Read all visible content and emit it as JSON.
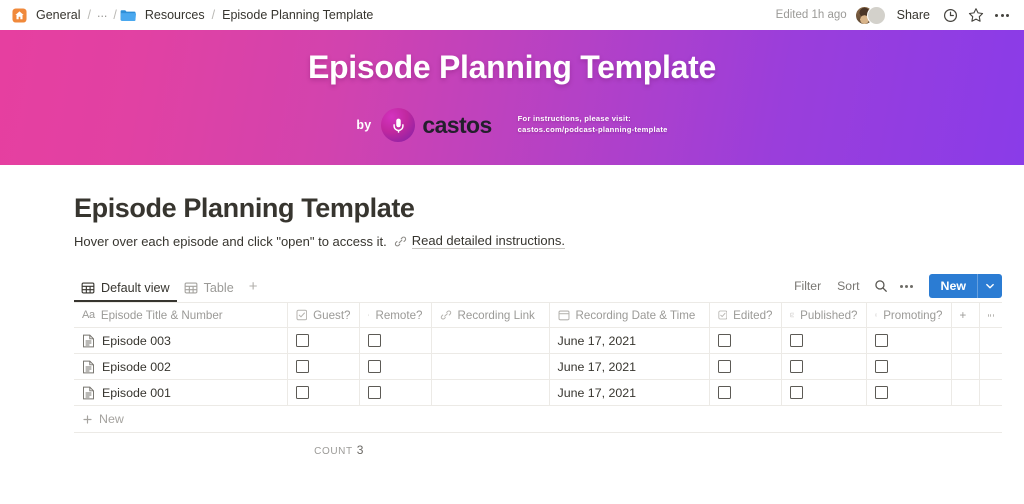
{
  "topbar": {
    "breadcrumb": {
      "home_icon": "home-icon",
      "home_label": "General",
      "sep": "/",
      "ellipsis": "...",
      "folder_icon": "folder-icon",
      "folder_label": "Resources",
      "page_label": "Episode Planning Template"
    },
    "edited_text": "Edited 1h ago",
    "share_label": "Share",
    "icons": [
      "clock-icon",
      "star-icon",
      "more-options-icon"
    ]
  },
  "banner": {
    "title": "Episode Planning Template",
    "by_word": "by",
    "brand": "castos",
    "mic_icon": "microphone-icon",
    "note_line1": "For instructions, please visit:",
    "note_line2": "castos.com/podcast-planning-template",
    "gradient_start": "#e63fa0",
    "gradient_end": "#8a3ce8"
  },
  "page": {
    "title": "Episode Planning Template",
    "subtitle": "Hover over each episode and click \"open\" to access it.",
    "link_icon": "link-icon",
    "link_label": "Read detailed instructions."
  },
  "view": {
    "tabs": [
      {
        "label": "Default view",
        "icon": "table-grid-icon",
        "active": true
      },
      {
        "label": "Table",
        "icon": "table-grid-icon",
        "active": false
      }
    ],
    "add_view_label": "+",
    "tools": {
      "filter_label": "Filter",
      "sort_label": "Sort",
      "search_icon": "search-icon",
      "more_icon": "more-options-icon",
      "new_label": "New",
      "new_chevron_icon": "chevron-down-icon",
      "new_color": "#2b7cd3"
    }
  },
  "table": {
    "columns": [
      {
        "label": "Episode Title & Number",
        "icon": "text-type-icon"
      },
      {
        "label": "Guest?",
        "icon": "checkbox-type-icon"
      },
      {
        "label": "Remote?",
        "icon": "checkbox-type-icon"
      },
      {
        "label": "Recording Link",
        "icon": "link-type-icon"
      },
      {
        "label": "Recording Date & Time",
        "icon": "calendar-type-icon"
      },
      {
        "label": "Edited?",
        "icon": "checkbox-type-icon"
      },
      {
        "label": "Published?",
        "icon": "checkbox-type-icon"
      },
      {
        "label": "Promoting?",
        "icon": "checkbox-type-icon"
      }
    ],
    "add_column_label": "+",
    "column_options_icon": "more-options-icon",
    "rows": [
      {
        "icon": "page-doc-icon",
        "title": "Episode 003",
        "guest": false,
        "remote": false,
        "recording_link": "",
        "recording_date": "June 17, 2021",
        "edited": false,
        "published": false,
        "promoting": false
      },
      {
        "icon": "page-doc-icon",
        "title": "Episode 002",
        "guest": false,
        "remote": false,
        "recording_link": "",
        "recording_date": "June 17, 2021",
        "edited": false,
        "published": false,
        "promoting": false
      },
      {
        "icon": "page-doc-icon",
        "title": "Episode 001",
        "guest": false,
        "remote": false,
        "recording_link": "",
        "recording_date": "June 17, 2021",
        "edited": false,
        "published": false,
        "promoting": false
      }
    ],
    "new_row_label": "New",
    "count_label": "COUNT",
    "count_value": "3"
  }
}
